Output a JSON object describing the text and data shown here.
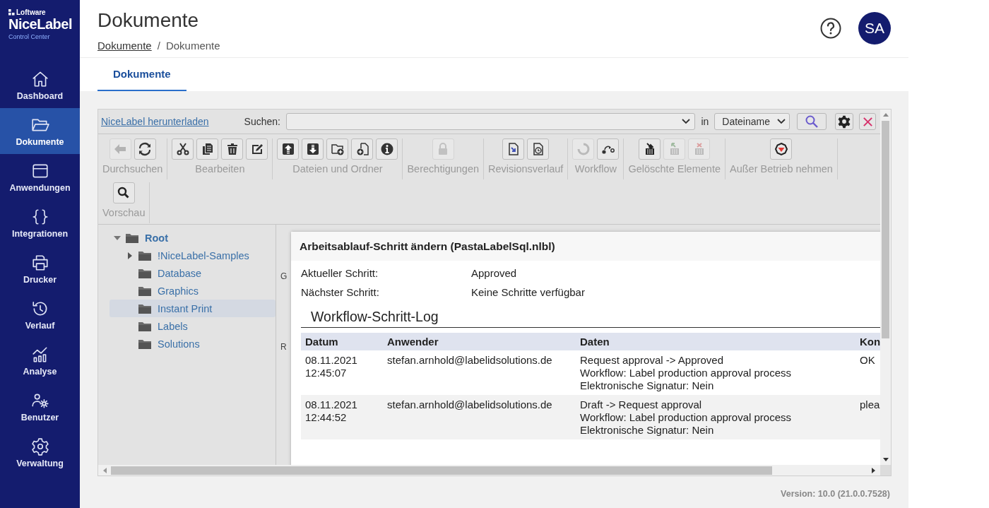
{
  "sidebar": {
    "brand": {
      "vendor": "Loftware",
      "product": "NiceLabel",
      "subtitle": "Control Center"
    },
    "items": [
      {
        "label": "Dashboard",
        "kind": "home",
        "selected": false
      },
      {
        "label": "Dokumente",
        "kind": "folder",
        "selected": true
      },
      {
        "label": "Anwendungen",
        "kind": "window",
        "selected": false
      },
      {
        "label": "Integrationen",
        "kind": "braces",
        "selected": false
      },
      {
        "label": "Drucker",
        "kind": "printer",
        "selected": false
      },
      {
        "label": "Verlauf",
        "kind": "history",
        "selected": false
      },
      {
        "label": "Analyse",
        "kind": "chart",
        "selected": false
      },
      {
        "label": "Benutzer",
        "kind": "users",
        "selected": false
      },
      {
        "label": "Verwaltung",
        "kind": "gear",
        "selected": false
      }
    ]
  },
  "header": {
    "title": "Dokumente",
    "breadcrumb": [
      {
        "label": "Dokumente",
        "link": true
      },
      {
        "label": "Dokumente",
        "link": false
      }
    ],
    "separator": "/",
    "avatar": "SA"
  },
  "tabs": [
    {
      "label": "Dokumente",
      "selected": true
    }
  ],
  "app": {
    "download_link": "NiceLabel herunterladen",
    "search_label": "Suchen:",
    "in_label": "in",
    "scope": "Dateiname",
    "toolbar_rows": [
      [
        {
          "label": "Durchsuchen",
          "buttons": [
            {
              "kind": "back",
              "disabled": true
            },
            {
              "kind": "refresh",
              "disabled": false
            }
          ]
        },
        {
          "label": "Bearbeiten",
          "buttons": [
            {
              "kind": "cut",
              "disabled": false
            },
            {
              "kind": "copy",
              "disabled": false
            },
            {
              "kind": "trash",
              "disabled": false
            },
            {
              "kind": "edit",
              "disabled": false
            }
          ]
        },
        {
          "label": "Dateien und Ordner",
          "buttons": [
            {
              "kind": "upload",
              "disabled": false
            },
            {
              "kind": "download",
              "disabled": false
            },
            {
              "kind": "folder-add",
              "disabled": false
            },
            {
              "kind": "file-add",
              "disabled": false
            },
            {
              "kind": "info",
              "disabled": false
            }
          ]
        },
        {
          "label": "Berechtigungen",
          "buttons": [
            {
              "kind": "lock",
              "disabled": true
            }
          ]
        },
        {
          "label": "Revisionsverlauf",
          "buttons": [
            {
              "kind": "file-arrow",
              "disabled": false
            },
            {
              "kind": "file-clock",
              "disabled": false
            }
          ]
        },
        {
          "label": "Workflow",
          "buttons": [
            {
              "kind": "cycle",
              "disabled": true
            },
            {
              "kind": "workflow",
              "disabled": false
            }
          ]
        },
        {
          "label": "Gelöschte Elemente",
          "buttons": [
            {
              "kind": "bin-pin",
              "disabled": false
            },
            {
              "kind": "bin-restore",
              "disabled": true
            },
            {
              "kind": "bin-delete",
              "disabled": true
            }
          ]
        },
        {
          "label": "Außer Betrieb nehmen",
          "buttons": [
            {
              "kind": "retire",
              "disabled": false
            }
          ]
        }
      ],
      [
        {
          "label": "Vorschau",
          "buttons": [
            {
              "kind": "preview",
              "disabled": false
            }
          ]
        }
      ]
    ],
    "tree": [
      {
        "label": "Root",
        "expanded": true,
        "selected": false,
        "children": [
          {
            "label": "!NiceLabel-Samples",
            "expanded": false,
            "selected": false
          },
          {
            "label": "Database",
            "selected": false
          },
          {
            "label": "Graphics",
            "selected": false
          },
          {
            "label": "Instant Print",
            "selected": true
          },
          {
            "label": "Labels",
            "selected": false
          },
          {
            "label": "Solutions",
            "selected": false
          }
        ]
      }
    ],
    "background_texts": [
      "G",
      "R"
    ],
    "dialog": {
      "title": "Arbeitsablauf-Schritt ändern (PastaLabelSql.nlbl)",
      "fields": [
        {
          "label": "Aktueller Schritt:",
          "value": "Approved"
        },
        {
          "label": "Nächster Schritt:",
          "value": "Keine Schritte verfügbar"
        }
      ],
      "section": "Workflow-Schritt-Log",
      "columns": [
        "Datum",
        "Anwender",
        "Daten",
        "Kon"
      ],
      "rows": [
        {
          "cells": [
            "08.11.2021\n12:45:07",
            "stefan.arnhold@labelidsolutions.de",
            "Request approval -> Approved\nWorkflow: Label production approval process\nElektronische Signatur: Nein",
            "OK"
          ]
        },
        {
          "cells": [
            "08.11.2021\n12:44:52",
            "stefan.arnhold@labelidsolutions.de",
            "Draft -> Request approval\nWorkflow: Label production approval process\nElektronische Signatur: Nein",
            "plea"
          ]
        }
      ]
    }
  },
  "version": "Version: 10.0 (21.0.0.7528)"
}
